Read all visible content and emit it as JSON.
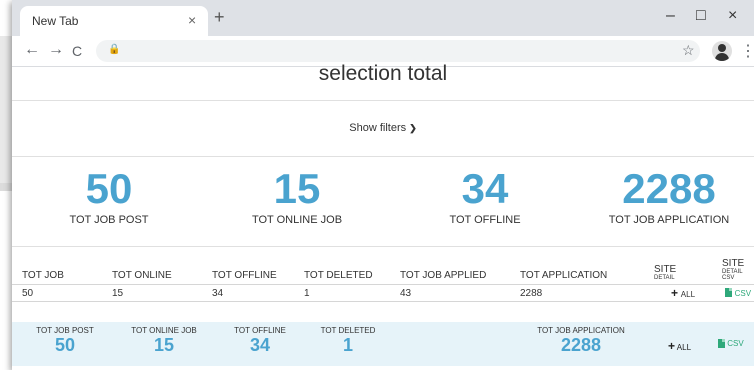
{
  "browser": {
    "tab_title": "New Tab",
    "tab_close": "×",
    "new_tab": "+",
    "minimize": "–",
    "maximize": "□",
    "close": "×",
    "back": "←",
    "forward": "→",
    "reload": "C",
    "lock": "🔒",
    "star": "☆",
    "menu": "⋮"
  },
  "page": {
    "title": "selection total",
    "show_filters": "Show filters"
  },
  "stats": [
    {
      "value": "50",
      "label": "TOT JOB POST"
    },
    {
      "value": "15",
      "label": "TOT ONLINE JOB"
    },
    {
      "value": "34",
      "label": "TOT OFFLINE"
    },
    {
      "value": "2288",
      "label": "TOT JOB APPLICATION"
    }
  ],
  "table": {
    "headers": [
      "TOT JOB",
      "TOT ONLINE",
      "TOT OFFLINE",
      "TOT DELETED",
      "TOT JOB APPLIED",
      "TOT APPLICATION"
    ],
    "site_header": {
      "title": "SITE",
      "sub": "DETAIL"
    },
    "site_csv_header": {
      "title": "SITE",
      "sub": "DETAIL CSV"
    },
    "row": [
      "50",
      "15",
      "34",
      "1",
      "43",
      "2288"
    ],
    "all_label": "ALL",
    "csv_label": "CSV"
  },
  "summary": [
    {
      "label": "TOT JOB POST",
      "value": "50"
    },
    {
      "label": "TOT ONLINE JOB",
      "value": "15"
    },
    {
      "label": "TOT OFFLINE",
      "value": "34"
    },
    {
      "label": "TOT DELETED",
      "value": "1"
    },
    {
      "label": "TOT JOB APPLICATION",
      "value": "2288"
    }
  ],
  "summary_all": "ALL",
  "summary_csv": "CSV",
  "colors": {
    "accent": "#4aa3cf",
    "csv_green": "#2ea87a",
    "summary_bg": "#e6f3f9"
  }
}
